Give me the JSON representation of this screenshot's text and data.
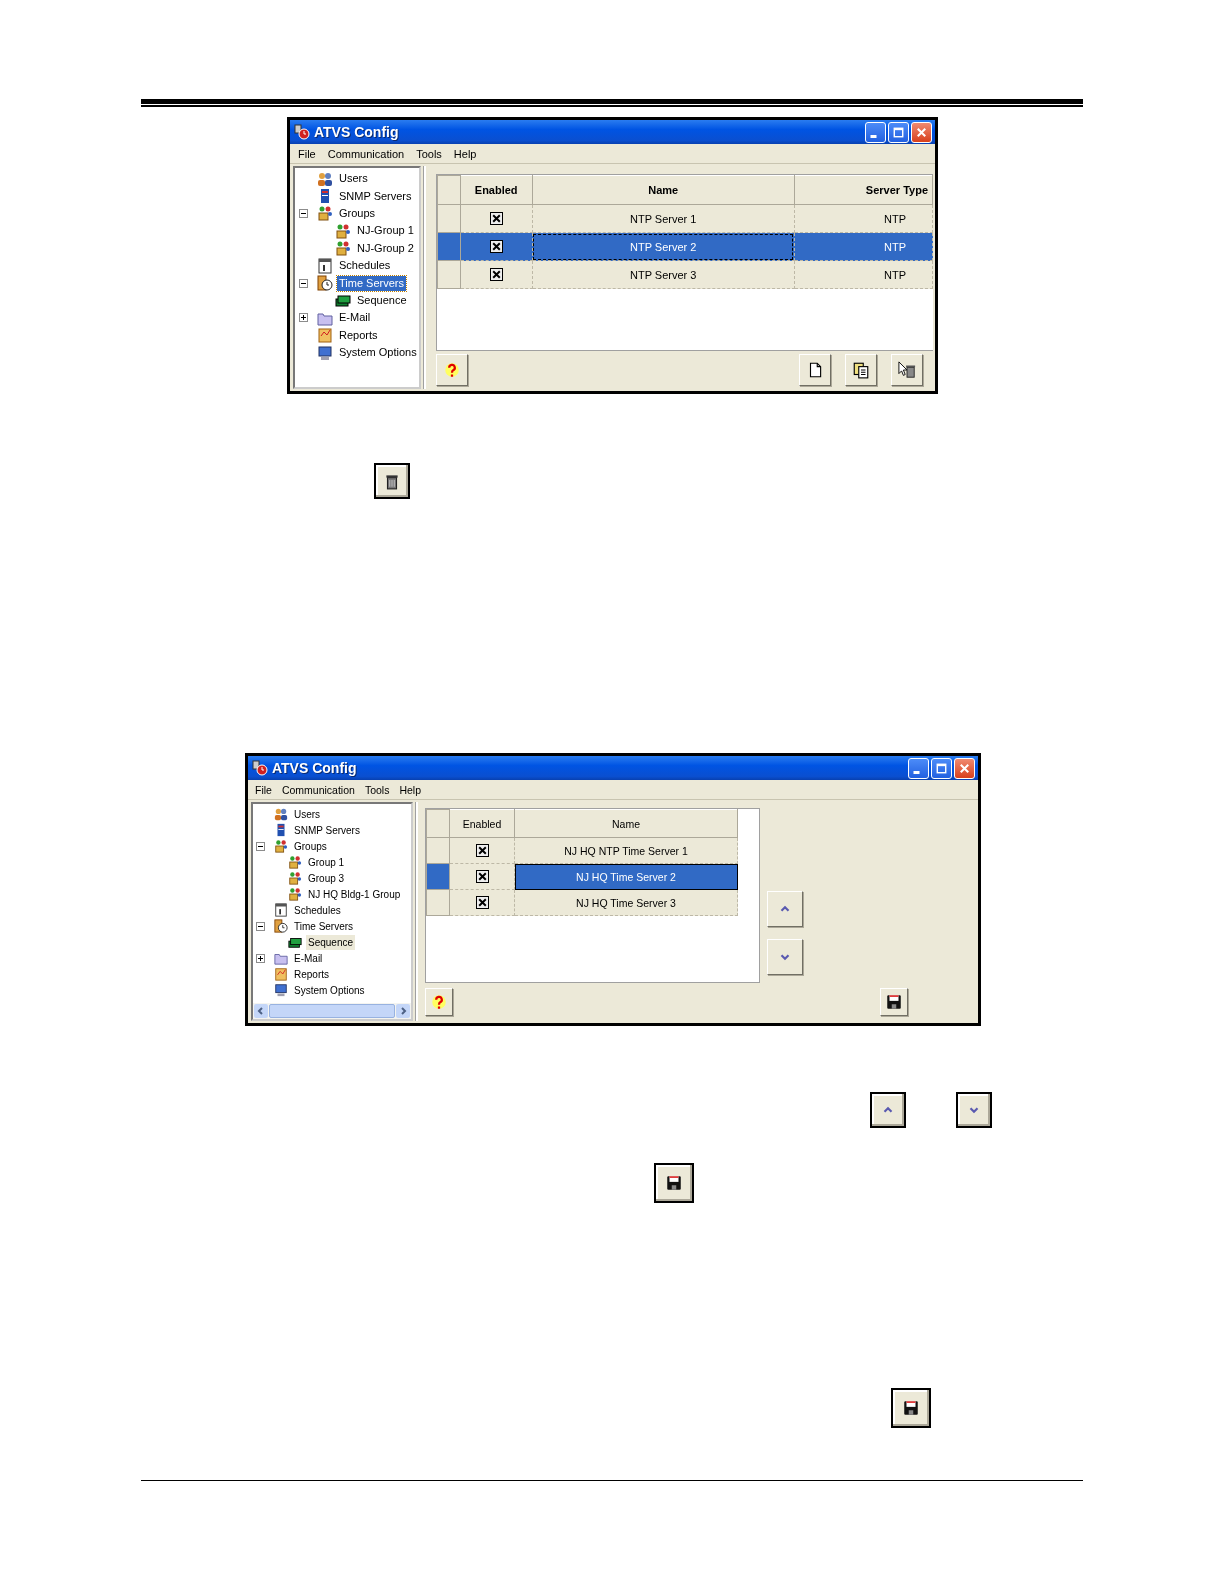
{
  "windows": [
    {
      "title": "ATVS Config",
      "menu": [
        "File",
        "Communication",
        "Tools",
        "Help"
      ],
      "tree": {
        "focused": true,
        "items": [
          {
            "label": "Users",
            "kind": "users",
            "selected": false
          },
          {
            "label": "SNMP Servers",
            "kind": "snmp",
            "selected": false
          },
          {
            "label": "Groups",
            "kind": "groups",
            "selected": false,
            "expanded": true,
            "children": [
              {
                "label": "NJ-Group 1",
                "kind": "group",
                "selected": false
              },
              {
                "label": "NJ-Group 2",
                "kind": "group",
                "selected": false
              }
            ]
          },
          {
            "label": "Schedules",
            "kind": "schedules",
            "selected": false
          },
          {
            "label": "Time Servers",
            "kind": "timeservers",
            "selected": true,
            "expanded": true,
            "children": [
              {
                "label": "Sequence",
                "kind": "sequence",
                "selected": false
              }
            ]
          },
          {
            "label": "E-Mail",
            "kind": "email",
            "selected": false,
            "expanded": false
          },
          {
            "label": "Reports",
            "kind": "reports",
            "selected": false
          },
          {
            "label": "System Options",
            "kind": "options",
            "selected": false
          }
        ]
      },
      "table": {
        "columns": [
          "Enabled",
          "Name",
          "Server Type"
        ],
        "rows": [
          {
            "enabled": true,
            "name": "NTP Server 1",
            "server_type": "NTP",
            "selected": false
          },
          {
            "enabled": true,
            "name": "NTP Server 2",
            "server_type": "NTP",
            "selected": true
          },
          {
            "enabled": true,
            "name": "NTP Server 3",
            "server_type": "NTP",
            "selected": false
          }
        ]
      },
      "footer_left": [
        {
          "kind": "help"
        }
      ],
      "footer_right": [
        {
          "kind": "new"
        },
        {
          "kind": "copy"
        },
        {
          "kind": "delete"
        }
      ]
    },
    {
      "title": "ATVS Config",
      "menu": [
        "File",
        "Communication",
        "Tools",
        "Help"
      ],
      "tree": {
        "focused": false,
        "scrollbar": true,
        "items": [
          {
            "label": "Users",
            "kind": "users",
            "selected": false
          },
          {
            "label": "SNMP Servers",
            "kind": "snmp",
            "selected": false
          },
          {
            "label": "Groups",
            "kind": "groups",
            "selected": false,
            "expanded": true,
            "children": [
              {
                "label": "Group 1",
                "kind": "group",
                "selected": false
              },
              {
                "label": "Group 3",
                "kind": "group",
                "selected": false
              },
              {
                "label": "NJ HQ Bldg-1 Group",
                "kind": "group",
                "selected": false
              }
            ]
          },
          {
            "label": "Schedules",
            "kind": "schedules",
            "selected": false
          },
          {
            "label": "Time Servers",
            "kind": "timeservers",
            "selected": false,
            "expanded": true,
            "children": [
              {
                "label": "Sequence",
                "kind": "sequence",
                "selected": true
              }
            ]
          },
          {
            "label": "E-Mail",
            "kind": "email",
            "selected": false,
            "expanded": false
          },
          {
            "label": "Reports",
            "kind": "reports",
            "selected": false
          },
          {
            "label": "System Options",
            "kind": "options",
            "selected": false
          }
        ]
      },
      "table": {
        "columns": [
          "Enabled",
          "Name"
        ],
        "rows": [
          {
            "enabled": true,
            "name": "NJ HQ NTP Time Server 1",
            "selected": false
          },
          {
            "enabled": true,
            "name": "NJ HQ Time Server 2",
            "selected": true
          },
          {
            "enabled": true,
            "name": "NJ HQ Time Server 3",
            "selected": false
          }
        ]
      },
      "side_buttons": [
        {
          "kind": "up"
        },
        {
          "kind": "down"
        }
      ],
      "footer_left": [
        {
          "kind": "help"
        }
      ],
      "footer_right": [
        {
          "kind": "save"
        }
      ]
    }
  ],
  "page_buttons": [
    {
      "kind": "delete_plain"
    },
    {
      "kind": "up"
    },
    {
      "kind": "down"
    },
    {
      "kind": "save"
    },
    {
      "kind": "save"
    }
  ]
}
